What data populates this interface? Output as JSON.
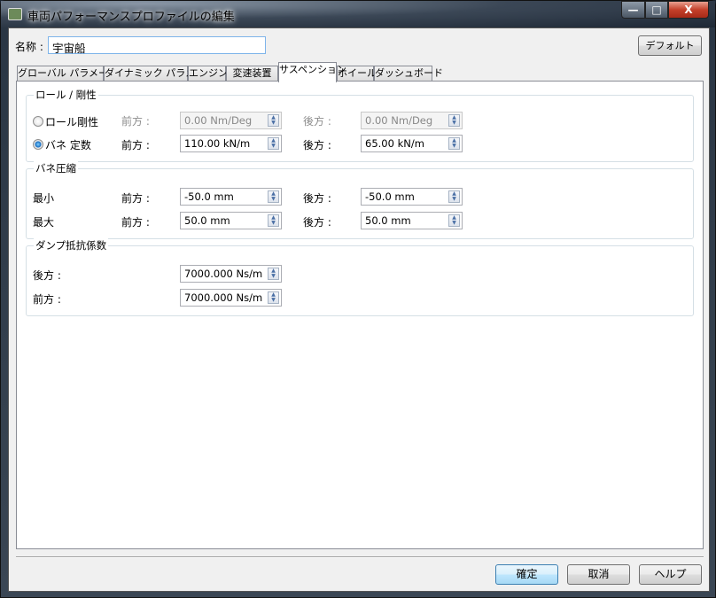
{
  "window": {
    "title": "車両パフォーマンスプロファイルの編集",
    "minimize": "—",
    "maximize": "□",
    "close": "X"
  },
  "name": {
    "label": "名称 :",
    "value": "宇宙船"
  },
  "default_button": "デフォルト",
  "tabs": [
    {
      "label": "グローバル パラメータ"
    },
    {
      "label": "ダイナミック パラメータ"
    },
    {
      "label": "エンジン"
    },
    {
      "label": "変速装置"
    },
    {
      "label": "サスペンション",
      "selected": true
    },
    {
      "label": "ホイール"
    },
    {
      "label": "ダッシュボード"
    }
  ],
  "roll": {
    "title": "ロール / 剛性",
    "rows": [
      {
        "option": "ロール剛性",
        "selected": false,
        "front_label": "前方 :",
        "front": "0.00 Nm/Deg",
        "rear_label": "後方 :",
        "rear": "0.00 Nm/Deg"
      },
      {
        "option": "バネ 定数",
        "selected": true,
        "front_label": "前方 :",
        "front": "110.00 kN/m",
        "rear_label": "後方 :",
        "rear": "65.00 kN/m"
      }
    ]
  },
  "compression": {
    "title": "バネ圧縮",
    "rows": [
      {
        "label": "最小",
        "front_label": "前方 :",
        "front": "-50.0 mm",
        "rear_label": "後方 :",
        "rear": "-50.0 mm"
      },
      {
        "label": "最大",
        "front_label": "前方 :",
        "front": "50.0 mm",
        "rear_label": "後方 :",
        "rear": "50.0 mm"
      }
    ]
  },
  "damping": {
    "title": "ダンプ抵抗係数",
    "rows": [
      {
        "label": "後方 :",
        "value": "7000.000 Ns/m"
      },
      {
        "label": "前方 :",
        "value": "7000.000 Ns/m"
      }
    ]
  },
  "footer": {
    "ok": "確定",
    "cancel": "取消",
    "help": "ヘルプ"
  }
}
